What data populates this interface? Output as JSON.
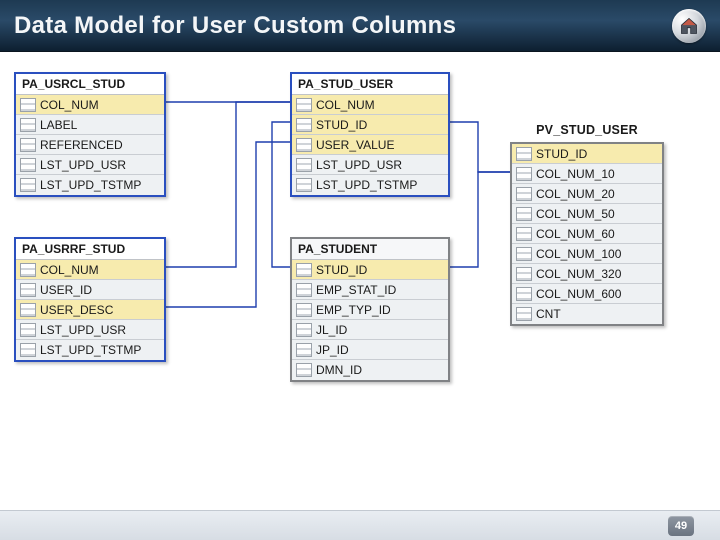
{
  "title": "Data Model for User Custom Columns",
  "page_number": "49",
  "tables": {
    "usrcl": {
      "name": "PA_USRCL_STUD",
      "cols": [
        {
          "label": "COL_NUM",
          "key": true
        },
        {
          "label": "LABEL",
          "key": false
        },
        {
          "label": "REFERENCED",
          "key": false
        },
        {
          "label": "LST_UPD_USR",
          "key": false
        },
        {
          "label": "LST_UPD_TSTMP",
          "key": false
        }
      ]
    },
    "usrrf": {
      "name": "PA_USRRF_STUD",
      "cols": [
        {
          "label": "COL_NUM",
          "key": true
        },
        {
          "label": "USER_ID",
          "key": false
        },
        {
          "label": "USER_DESC",
          "key": true
        },
        {
          "label": "LST_UPD_USR",
          "key": false
        },
        {
          "label": "LST_UPD_TSTMP",
          "key": false
        }
      ]
    },
    "studu": {
      "name": "PA_STUD_USER",
      "cols": [
        {
          "label": "COL_NUM",
          "key": true
        },
        {
          "label": "STUD_ID",
          "key": true
        },
        {
          "label": "USER_VALUE",
          "key": true
        },
        {
          "label": "LST_UPD_USR",
          "key": false
        },
        {
          "label": "LST_UPD_TSTMP",
          "key": false
        }
      ]
    },
    "stud": {
      "name": "PA_STUDENT",
      "cols": [
        {
          "label": "STUD_ID",
          "key": true
        },
        {
          "label": "EMP_STAT_ID",
          "key": false
        },
        {
          "label": "EMP_TYP_ID",
          "key": false
        },
        {
          "label": "JL_ID",
          "key": false
        },
        {
          "label": "JP_ID",
          "key": false
        },
        {
          "label": "DMN_ID",
          "key": false
        }
      ]
    },
    "pv": {
      "name": "PV_STUD_USER",
      "cols": [
        {
          "label": "STUD_ID",
          "key": true
        },
        {
          "label": "COL_NUM_10",
          "key": false
        },
        {
          "label": "COL_NUM_20",
          "key": false
        },
        {
          "label": "COL_NUM_50",
          "key": false
        },
        {
          "label": "COL_NUM_60",
          "key": false
        },
        {
          "label": "COL_NUM_100",
          "key": false
        },
        {
          "label": "COL_NUM_320",
          "key": false
        },
        {
          "label": "COL_NUM_600",
          "key": false
        },
        {
          "label": "CNT",
          "key": false
        }
      ]
    }
  }
}
